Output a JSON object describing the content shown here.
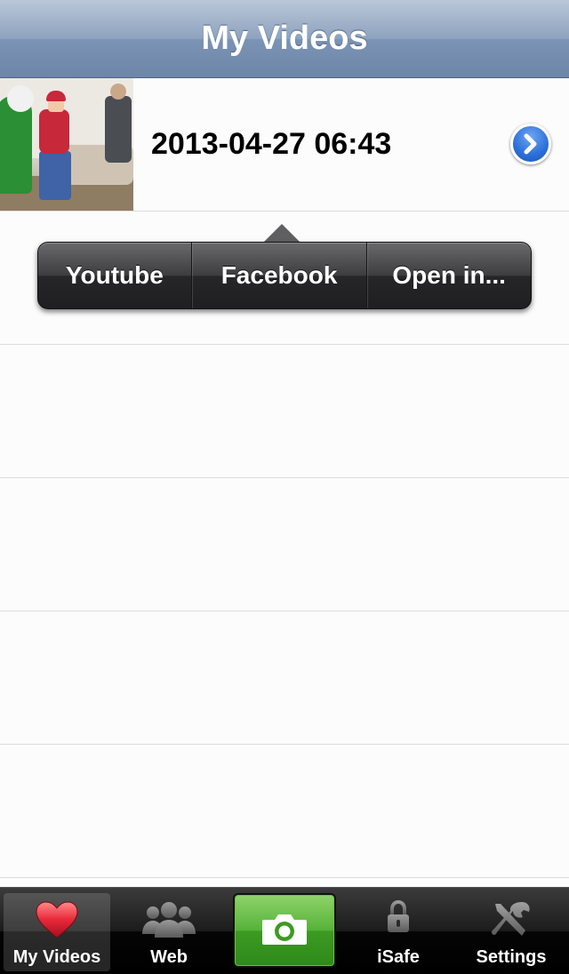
{
  "navbar": {
    "title": "My Videos"
  },
  "videos": [
    {
      "title": "2013-04-27 06:43"
    }
  ],
  "share_menu": {
    "youtube_label": "Youtube",
    "facebook_label": "Facebook",
    "open_in_label": "Open in..."
  },
  "tabbar": {
    "tabs": [
      {
        "label": "My Videos",
        "icon": "heart-icon",
        "selected": true
      },
      {
        "label": "Web",
        "icon": "people-icon",
        "selected": false
      },
      {
        "label": "",
        "icon": "camera-icon",
        "selected": false
      },
      {
        "label": "iSafe",
        "icon": "lock-icon",
        "selected": false
      },
      {
        "label": "Settings",
        "icon": "tools-icon",
        "selected": false
      }
    ]
  },
  "colors": {
    "accent_blue": "#2a6fd8",
    "camera_green": "#56b238",
    "heart_red": "#e8283a"
  }
}
